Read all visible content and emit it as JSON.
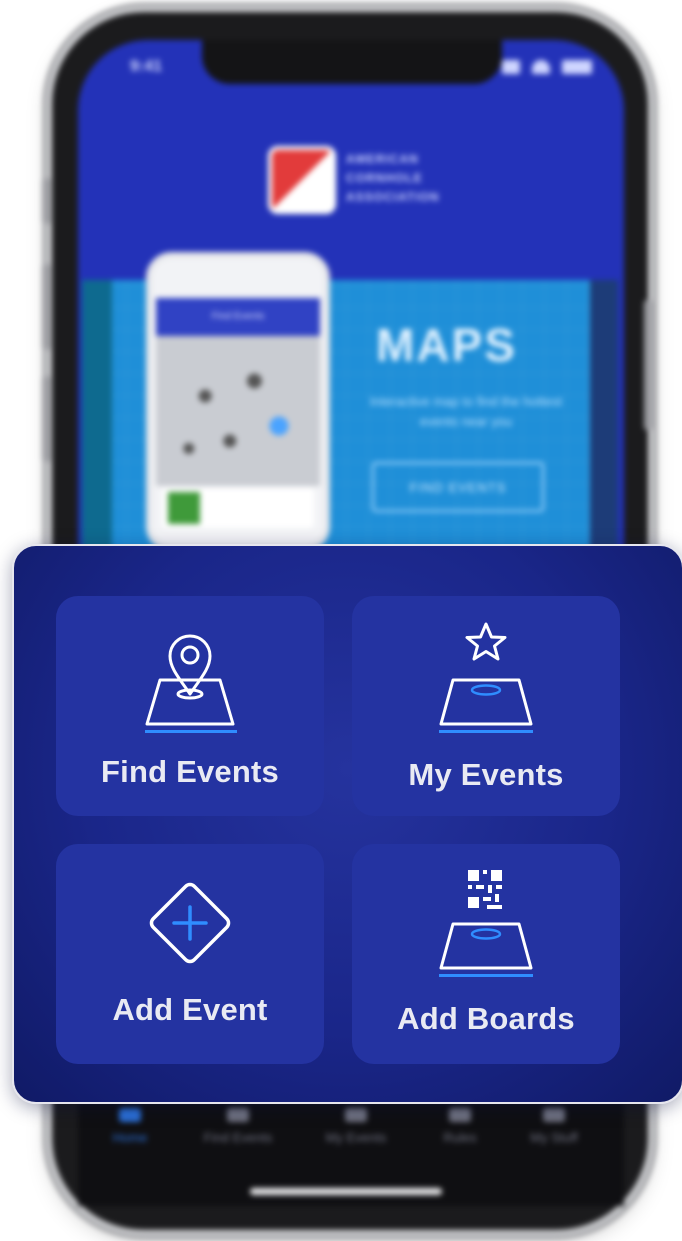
{
  "status_bar": {
    "time": "9:41"
  },
  "header": {
    "logo_text_lines": [
      "AMERICAN",
      "CORNHOLE",
      "ASSOCIATION"
    ]
  },
  "banner": {
    "title": "MAPS",
    "description": "Interactive map to find the hottest events near you",
    "button_label": "FIND EVENTS",
    "mini_app_title": "Find Events"
  },
  "tiles": [
    {
      "label": "Find Events",
      "icon": "map-pin-icon"
    },
    {
      "label": "My Events",
      "icon": "star-board-icon"
    },
    {
      "label": "Add Event",
      "icon": "add-diamond-icon"
    },
    {
      "label": "Add Boards",
      "icon": "qr-board-icon"
    }
  ],
  "tabbar": {
    "items": [
      {
        "label": "Home",
        "active": true
      },
      {
        "label": "Find Events",
        "active": false
      },
      {
        "label": "My Events",
        "active": false
      },
      {
        "label": "Rules",
        "active": false
      },
      {
        "label": "My Stuff",
        "active": false
      }
    ]
  },
  "colors": {
    "panel": "#1a2689",
    "tile": "#2433a1",
    "accent": "#2f8dff",
    "tile_text": "#e9eaf3"
  }
}
